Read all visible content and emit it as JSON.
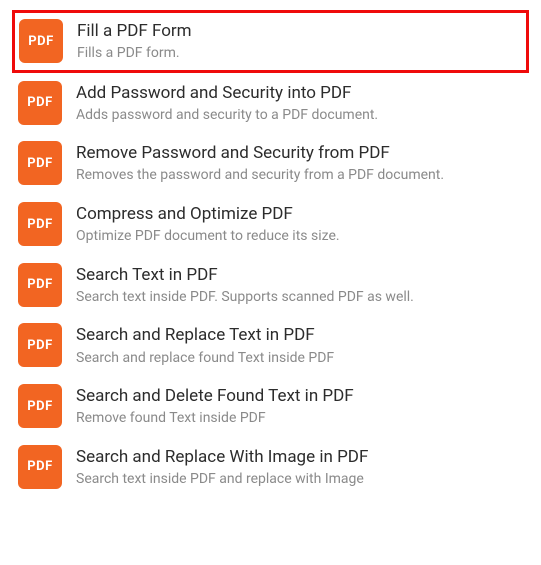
{
  "icon_label": "PDF",
  "colors": {
    "icon_bg": "#f26522",
    "highlight_border": "#ef0a0a"
  },
  "actions": [
    {
      "title": "Fill a PDF Form",
      "description": "Fills a PDF form.",
      "name": "fill-pdf-form",
      "highlighted": true
    },
    {
      "title": "Add Password and Security into PDF",
      "description": "Adds password and security to a PDF document.",
      "name": "add-password-security",
      "highlighted": false
    },
    {
      "title": "Remove Password and Security from PDF",
      "description": "Removes the password and security from a PDF document.",
      "name": "remove-password-security",
      "highlighted": false
    },
    {
      "title": "Compress and Optimize PDF",
      "description": "Optimize PDF document to reduce its size.",
      "name": "compress-optimize-pdf",
      "highlighted": false
    },
    {
      "title": "Search Text in PDF",
      "description": "Search text inside PDF. Supports scanned PDF as well.",
      "name": "search-text-pdf",
      "highlighted": false
    },
    {
      "title": "Search and Replace Text in PDF",
      "description": "Search and replace found Text inside PDF",
      "name": "search-replace-text-pdf",
      "highlighted": false
    },
    {
      "title": "Search and Delete Found Text in PDF",
      "description": "Remove found Text inside PDF",
      "name": "search-delete-text-pdf",
      "highlighted": false
    },
    {
      "title": "Search and Replace With Image in PDF",
      "description": "Search text inside PDF and replace with Image",
      "name": "search-replace-image-pdf",
      "highlighted": false
    }
  ]
}
